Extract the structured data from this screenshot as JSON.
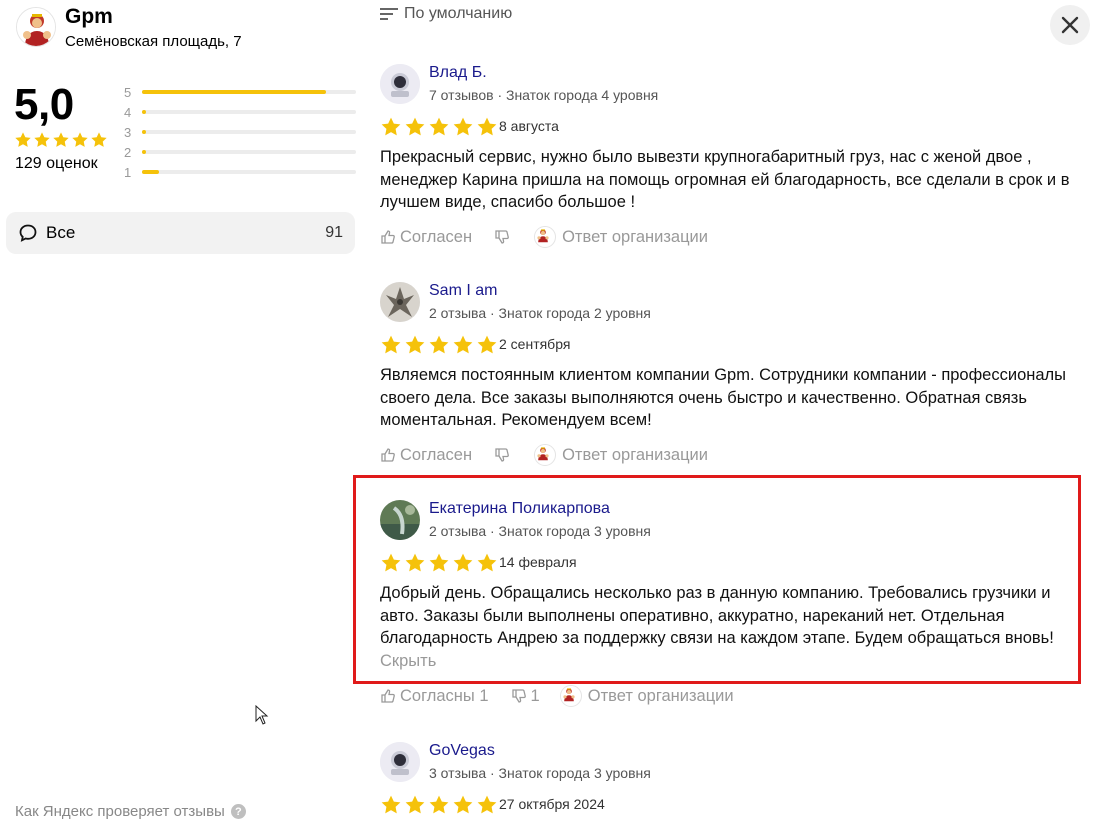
{
  "org": {
    "name": "Gpm",
    "address": "Семёновская площадь, 7",
    "rating": "5,0",
    "rating_count": "129 оценок",
    "distribution": [
      {
        "stars": "5",
        "fraction": 0.86
      },
      {
        "stars": "4",
        "fraction": 0.02
      },
      {
        "stars": "3",
        "fraction": 0.02
      },
      {
        "stars": "2",
        "fraction": 0.01
      },
      {
        "stars": "1",
        "fraction": 0.08
      }
    ]
  },
  "filter": {
    "label": "Все",
    "count": "91"
  },
  "footer": {
    "link": "Как Яндекс проверяет отзывы",
    "help": "?"
  },
  "sort": {
    "label": "По умолчанию"
  },
  "colors": {
    "star": "#f5c20a",
    "author": "#1a1a8c",
    "highlight": "#e01a1a",
    "muted": "#999999"
  },
  "reviews": [
    {
      "author": "Влад Б.",
      "meta": "7 отзывов · Знаток города 4 уровня",
      "rating": 5,
      "date": "8 августа",
      "text": "Прекрасный сервис, нужно было вывезти крупногабаритный груз, нас с женой двое , менеджер Карина пришла на помощь огромная ей благодарность, все сделали в срок и в лучшем виде, спасибо большое !",
      "hide": "",
      "agree": "Согласен",
      "disagree": "",
      "reply": "Ответ организации"
    },
    {
      "author": "Sam I am",
      "meta": "2 отзыва · Знаток города 2 уровня",
      "rating": 5,
      "date": "2 сентября",
      "text": "Являемся постоянным клиентом компании Gpm. Сотрудники компании - профессионалы своего дела. Все заказы выполняются очень быстро и качественно. Обратная связь моментальная. Рекомендуем всем!",
      "hide": "",
      "agree": "Согласен",
      "disagree": "",
      "reply": "Ответ организации"
    },
    {
      "author": "Екатерина Поликарпова",
      "meta": "2 отзыва · Знаток города 3 уровня",
      "rating": 5,
      "date": "14 февраля",
      "text": "Добрый день. Обращались несколько раз в данную компанию. Требовались грузчики и авто. Заказы были выполнены оперативно, аккуратно, нареканий нет. Отдельная благодарность Андрею за поддержку связи на каждом этапе. Будем обращаться вновь! ",
      "hide": "Скрыть",
      "agree": "Согласны 1",
      "disagree": "1",
      "reply": "Ответ организации"
    },
    {
      "author": "GoVegas",
      "meta": "3 отзыва · Знаток города 3 уровня",
      "rating": 5,
      "date": "27 октября 2024",
      "text": "",
      "hide": "",
      "agree": "",
      "disagree": "",
      "reply": ""
    }
  ]
}
